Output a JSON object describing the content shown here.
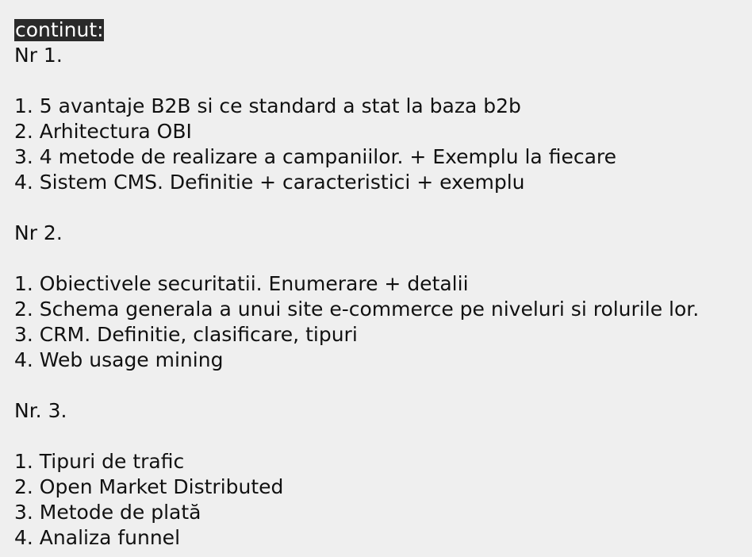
{
  "heading": "continut:",
  "sections": [
    {
      "title": "Nr 1.",
      "items": [
        "1. 5 avantaje B2B si ce standard a stat la baza b2b",
        "2. Arhitectura OBI",
        "3. 4 metode de realizare a campaniilor. + Exemplu la fiecare",
        "4. Sistem CMS. Definitie + caracteristici + exemplu"
      ]
    },
    {
      "title": "Nr 2.",
      "items": [
        "1. Obiectivele securitatii. Enumerare + detalii",
        "2. Schema generala a unui site e-commerce pe niveluri si rolurile lor.",
        "3. CRM. Definitie, clasificare, tipuri",
        "4. Web usage mining"
      ]
    },
    {
      "title": "Nr. 3.",
      "items": [
        "1. Tipuri de trafic",
        "2. Open Market Distributed",
        "3. Metode de plată",
        "4. Analiza funnel"
      ]
    }
  ]
}
